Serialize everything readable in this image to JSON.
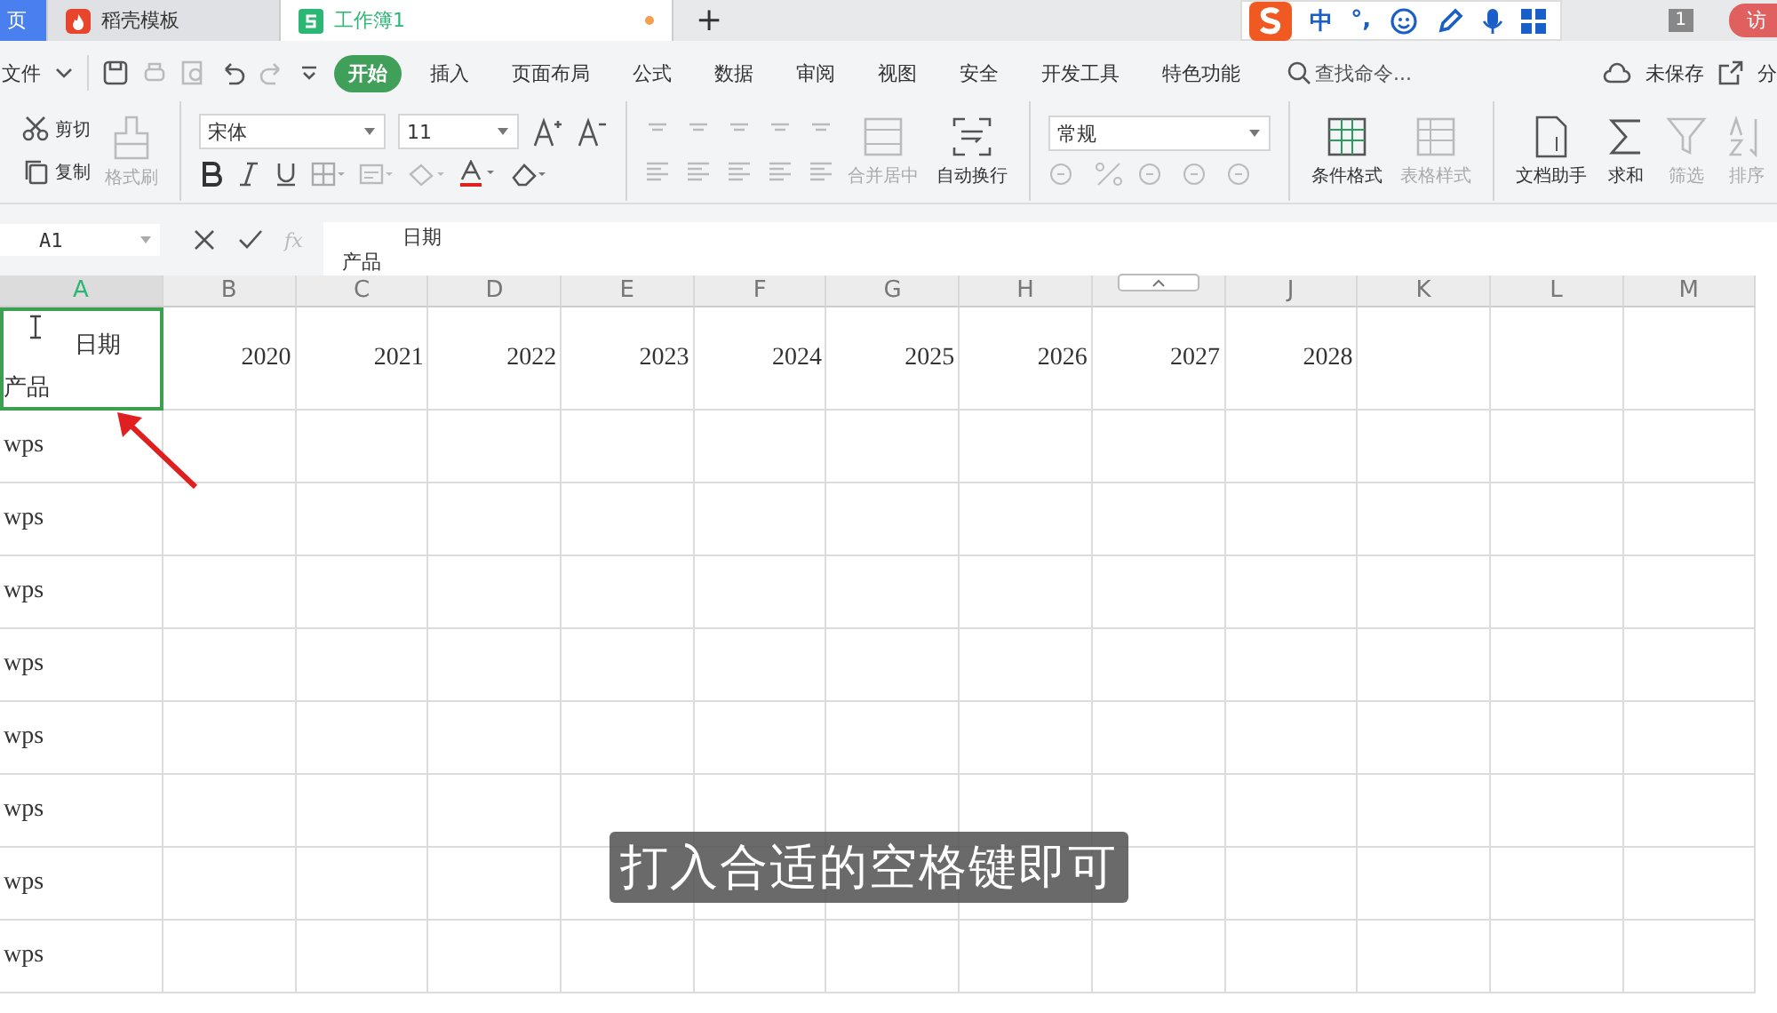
{
  "tabs": [
    {
      "label": "页",
      "kind": "home",
      "selected": false
    },
    {
      "label": "稻壳模板",
      "kind": "docer",
      "selected": false
    },
    {
      "label": "工作簿1",
      "kind": "sheet",
      "selected": true
    }
  ],
  "new_tab": "+",
  "ime_bar": {
    "items": [
      "中",
      "°,"
    ]
  },
  "page_count": "1",
  "user_button": "访",
  "menu": {
    "file": "文件",
    "tabs": [
      {
        "label": "开始",
        "selected": true
      },
      {
        "label": "插入",
        "selected": false
      },
      {
        "label": "页面布局",
        "selected": false
      },
      {
        "label": "公式",
        "selected": false
      },
      {
        "label": "数据",
        "selected": false
      },
      {
        "label": "审阅",
        "selected": false
      },
      {
        "label": "视图",
        "selected": false
      },
      {
        "label": "安全",
        "selected": false
      },
      {
        "label": "开发工具",
        "selected": false
      },
      {
        "label": "特色功能",
        "selected": false
      }
    ],
    "search": {
      "placeholder": "查找命令..."
    },
    "save_status": "未保存",
    "share": "分"
  },
  "toolbar": {
    "clipboard": [
      {
        "kind": "cut",
        "label": "剪切",
        "disabled": false
      },
      {
        "kind": "copy",
        "label": "复制",
        "disabled": false
      }
    ],
    "format_painter": {
      "label": "格式刷",
      "disabled": true
    },
    "font": {
      "name": "宋体",
      "size": "11"
    },
    "big_buttons": [
      {
        "kind": "merge",
        "label": "合并居中",
        "disabled": true
      },
      {
        "kind": "wrap",
        "label": "自动换行",
        "disabled": false
      }
    ],
    "number_format": "常规",
    "right_buttons": [
      {
        "kind": "conditional",
        "label": "条件格式",
        "disabled": false
      },
      {
        "kind": "table",
        "label": "表格样式",
        "disabled": true
      },
      {
        "kind": "doc",
        "label": "文档助手",
        "disabled": false
      },
      {
        "kind": "sum",
        "label": "求和",
        "disabled": false
      },
      {
        "kind": "filter",
        "label": "筛选",
        "disabled": true
      },
      {
        "kind": "sort",
        "label": "排序",
        "disabled": true
      }
    ]
  },
  "formula_bar": {
    "name_box": "A1",
    "fx": "fx",
    "content": [
      "日期",
      "产品"
    ]
  },
  "sheet": {
    "columns": [
      {
        "label": "A",
        "selected": true
      },
      {
        "label": "B",
        "selected": false
      },
      {
        "label": "C",
        "selected": false
      },
      {
        "label": "D",
        "selected": false
      },
      {
        "label": "E",
        "selected": false
      },
      {
        "label": "F",
        "selected": false
      },
      {
        "label": "G",
        "selected": false
      },
      {
        "label": "H",
        "selected": false
      },
      {
        "selected": false
      },
      {
        "label": "J",
        "selected": false
      },
      {
        "label": "K",
        "selected": false
      },
      {
        "label": "L",
        "selected": false
      },
      {
        "label": "M",
        "selected": false
      }
    ],
    "header_cell": {
      "lines": [
        "日期",
        "产品"
      ],
      "selected": true
    },
    "year_cells": [
      "2020",
      "2021",
      "2022",
      "2023",
      "2024",
      "2025",
      "2026",
      "2027",
      "2028"
    ],
    "rows": [
      "wps",
      "wps",
      "wps",
      "wps",
      "wps",
      "wps",
      "wps",
      "wps"
    ]
  },
  "caption": "打入合适的空格键即可"
}
